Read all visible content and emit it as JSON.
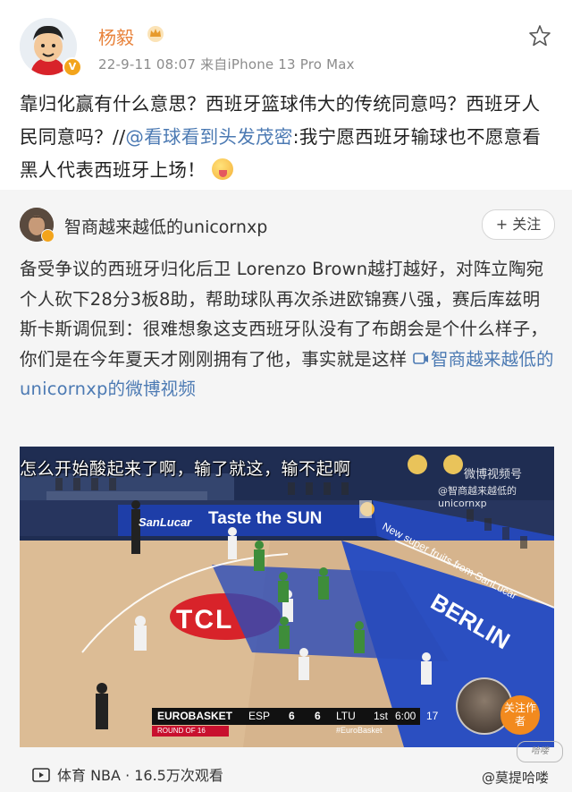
{
  "author": {
    "name": "杨毅",
    "timestamp": "22-9-11 08:07",
    "source": "来自iPhone 13 Pro Max"
  },
  "post": {
    "text_before": "靠归化赢有什么意思？西班牙篮球伟大的传统同意吗？西班牙人民同意吗？//",
    "mention": "@看球看到头发茂密",
    "text_after": ":我宁愿西班牙输球也不愿意看黑人代表西班牙上场！"
  },
  "repost": {
    "author": "智商越来越低的unicornxp",
    "follow_label": "+ 关注",
    "text": "备受争议的西班牙归化后卫 Lorenzo Brown越打越好，对阵立陶宛个人砍下28分3板8助，帮助球队再次杀进欧锦赛八强，赛后库兹明斯卡斯调侃到：很难想象这支西班牙队没有了布朗会是个什么样子，你们是在今年夏天才刚刚拥有了他，事实就是这样 ",
    "video_link": "智商越来越低的unicornxp的微博视频"
  },
  "video": {
    "caption": "怎么开始酸起来了啊，输了就这，输不起啊",
    "watermark": "微博视频号",
    "watermark_handle": "@智商越来越低的unicornxp",
    "ad_taste": "Taste the SUN",
    "ad_san": "SanLucar",
    "ad_right": "New super fruits from SanLucar",
    "court_tcl": "TCL",
    "court_berlin": "BERLIN",
    "score": {
      "event": "EUROBASKET",
      "home": "ESP",
      "home_score": "6",
      "away_score": "6",
      "away": "LTU",
      "period": "1st",
      "clock": "6:00",
      "shot_clock": "17",
      "round": "ROUND OF 16",
      "hashtag": "#EuroBasket"
    },
    "follow_author": "关注作者"
  },
  "footer": {
    "stats": "体育 NBA · 16.5万次观看",
    "watermark": "@莫提哈喽",
    "stamp": "哈喽"
  },
  "colors": {
    "username": "#e8823a",
    "link": "#4c7ab3",
    "repost_bg": "#f5f5f5",
    "badge": "#f3a41b"
  },
  "icons": [
    "star-icon",
    "crown-icon",
    "verified-icon",
    "video-link-icon",
    "play-icon",
    "emoji-drool-icon"
  ]
}
